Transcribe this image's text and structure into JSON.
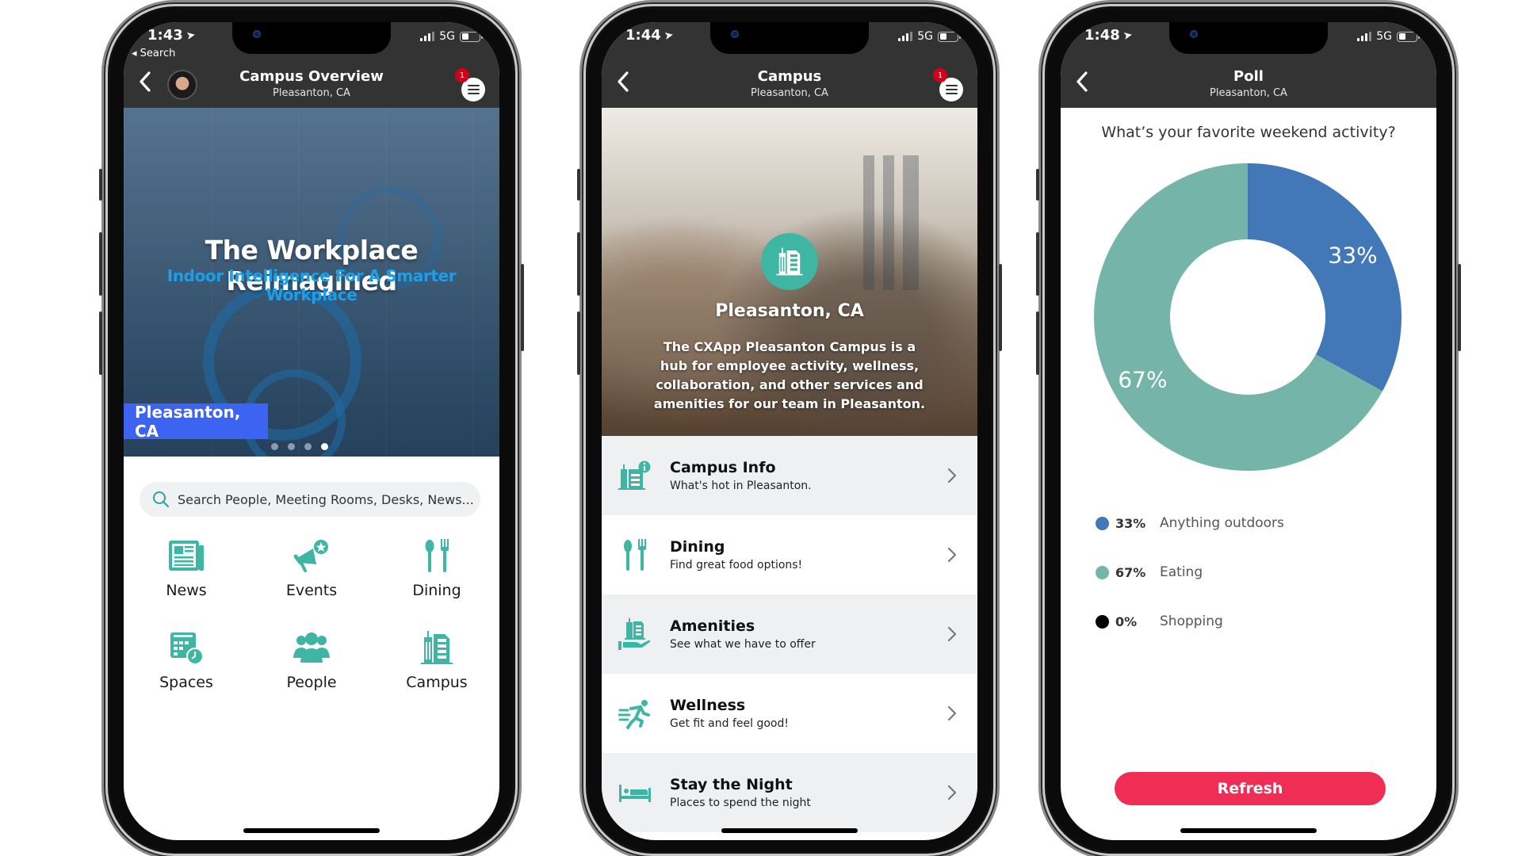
{
  "phones": [
    {
      "status": {
        "time": "1:43",
        "back_app": "Search",
        "network": "5G",
        "battery_level": 0.4
      },
      "header": {
        "title": "Campus Overview",
        "subtitle": "Pleasanton, CA",
        "notification_count": "1"
      },
      "hero": {
        "title": "The Workplace Reimagined",
        "subtitle": "Indoor Intelligence For A Smarter Workplace",
        "location_tag": "Pleasanton, CA",
        "carousel_pages": 4,
        "carousel_active": 4
      },
      "search": {
        "placeholder": "Search People, Meeting Rooms, Desks, News...",
        "value": ""
      },
      "grid": [
        {
          "label": "News",
          "icon": "newspaper-icon"
        },
        {
          "label": "Events",
          "icon": "megaphone-star-icon"
        },
        {
          "label": "Dining",
          "icon": "spoon-fork-icon"
        },
        {
          "label": "Spaces",
          "icon": "calendar-clock-icon"
        },
        {
          "label": "People",
          "icon": "people-group-icon"
        },
        {
          "label": "Campus",
          "icon": "building-icon"
        }
      ]
    },
    {
      "status": {
        "time": "1:44",
        "network": "5G",
        "battery_level": 0.4
      },
      "header": {
        "title": "Campus",
        "subtitle": "Pleasanton, CA",
        "notification_count": "1"
      },
      "hero": {
        "title": "Pleasanton, CA",
        "description": "The CXApp Pleasanton Campus is a hub for employee activity, wellness, collaboration, and other services and amenities for our team in Pleasanton."
      },
      "list": [
        {
          "title": "Campus Info",
          "desc": "What's hot in Pleasanton.",
          "icon": "building-info-icon"
        },
        {
          "title": "Dining",
          "desc": "Find great food options!",
          "icon": "spoon-fork-icon"
        },
        {
          "title": "Amenities",
          "desc": "See what we have to offer",
          "icon": "hand-building-icon"
        },
        {
          "title": "Wellness",
          "desc": "Get fit and feel good!",
          "icon": "running-person-icon"
        },
        {
          "title": "Stay the Night",
          "desc": "Places to spend the night",
          "icon": "bed-icon"
        }
      ]
    },
    {
      "status": {
        "time": "1:48",
        "network": "5G",
        "battery_level": 0.4
      },
      "header": {
        "title": "Poll",
        "subtitle": "Pleasanton, CA"
      },
      "poll": {
        "question": "What’s your favorite weekend activity?",
        "refresh_label": "Refresh"
      }
    }
  ],
  "colors": {
    "header": "#333333",
    "accent_teal": "#3fb5a3",
    "poll_blue": "#4378b8",
    "poll_teal": "#75b5a9",
    "poll_black": "#000000",
    "refresh": "#f02d55",
    "location_tag": "#3d63f2",
    "hero_subtitle": "#1e9ee6",
    "badge": "#d0021b"
  },
  "chart_data": {
    "type": "pie",
    "title": "What’s your favorite weekend activity?",
    "donut": true,
    "categories": [
      "Anything outdoors",
      "Eating",
      "Shopping"
    ],
    "values": [
      33,
      67,
      0
    ],
    "value_labels": [
      "33%",
      "67%",
      "0%"
    ],
    "colors": [
      "#4378b8",
      "#75b5a9",
      "#000000"
    ],
    "legend": "bottom-left",
    "start_angle": "top, clockwise"
  }
}
